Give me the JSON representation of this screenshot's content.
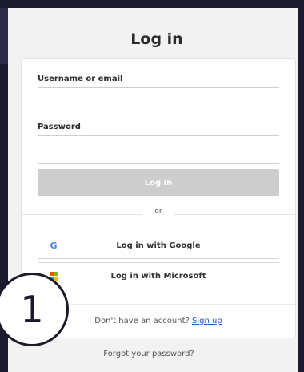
{
  "title": "Log in",
  "form": {
    "username_label": "Username or email",
    "username_value": "",
    "password_label": "Password",
    "password_value": "",
    "login_button": "Log in"
  },
  "divider_text": "or",
  "sso": {
    "google_label": "Log in with Google",
    "google_icon": "G",
    "microsoft_label": "Log in with Microsoft",
    "microsoft_colors": [
      "#f25022",
      "#7fba00",
      "#00a4ef",
      "#ffb900"
    ]
  },
  "signup": {
    "prompt": "Don't have an account?",
    "link": "Sign up"
  },
  "forgot_password": "Forgot your password?",
  "step_badge": "1",
  "colors": {
    "background": "#1c1a2e",
    "panel": "#f2f2f2",
    "login_button_disabled": "#cdcdcd",
    "link": "#2a55c9",
    "google_icon": "#4285f4"
  }
}
